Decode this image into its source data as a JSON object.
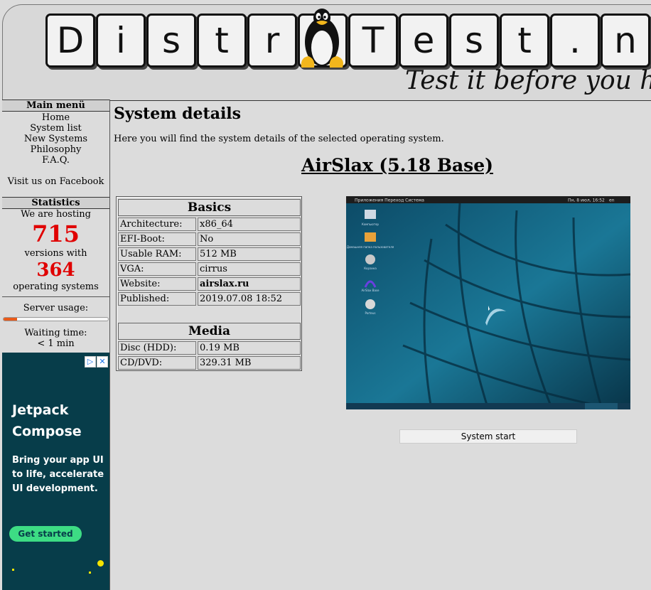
{
  "header": {
    "letters": [
      "D",
      "i",
      "s",
      "t",
      "r",
      "o",
      "T",
      "e",
      "s",
      "t",
      ".",
      "n"
    ],
    "slogan": "Test it before you ha"
  },
  "sidebar": {
    "menu_title": "Main menü",
    "menu_items": [
      {
        "label": "Home"
      },
      {
        "label": "System list"
      },
      {
        "label": "New Systems"
      },
      {
        "label": "Philosophy"
      },
      {
        "label": "F.A.Q."
      }
    ],
    "facebook": "Visit us on Facebook",
    "stats_title": "Statistics",
    "hosting_text": "We are hosting",
    "versions_count": "715",
    "versions_text": "versions with",
    "os_count": "364",
    "os_text": "operating systems",
    "server_usage_label": "Server usage:",
    "server_usage_fraction": 0.13,
    "waiting_label": "Waiting time:",
    "waiting_value": "< 1 min"
  },
  "ad": {
    "title": "Jetpack Compose",
    "text": "Bring your app UI to life, accelerate UI development.",
    "button": "Get started",
    "icons": [
      "ad-choices-icon",
      "close-icon"
    ]
  },
  "main": {
    "title": "System details",
    "intro": "Here you will find the system details of the selected operating system.",
    "system_name": "AirSlax (5.18 Base)",
    "basics_title": "Basics",
    "basics": [
      {
        "key": "Architecture:",
        "value": "x86_64"
      },
      {
        "key": "EFI-Boot:",
        "value": "No"
      },
      {
        "key": "Usable RAM:",
        "value": "512 MB"
      },
      {
        "key": "VGA:",
        "value": "cirrus"
      },
      {
        "key": "Website:",
        "value": "airslax.ru"
      },
      {
        "key": "Published:",
        "value": "2019.07.08 18:52"
      }
    ],
    "media_title": "Media",
    "media": [
      {
        "key": "Disc (HDD):",
        "value": "0.19 MB"
      },
      {
        "key": "CD/DVD:",
        "value": "329.31 MB"
      }
    ],
    "start_button": "System start"
  },
  "screenshot": {
    "menu": "Приложения  Переход  Система",
    "clock": "Пн, 8 июл, 16:52",
    "lang": "en",
    "icons": [
      {
        "label": "Компьютер"
      },
      {
        "label": "Домашняя папка пользователя"
      },
      {
        "label": "Корзина"
      },
      {
        "label": "AirSlax Base"
      },
      {
        "label": "Porteus"
      }
    ]
  }
}
